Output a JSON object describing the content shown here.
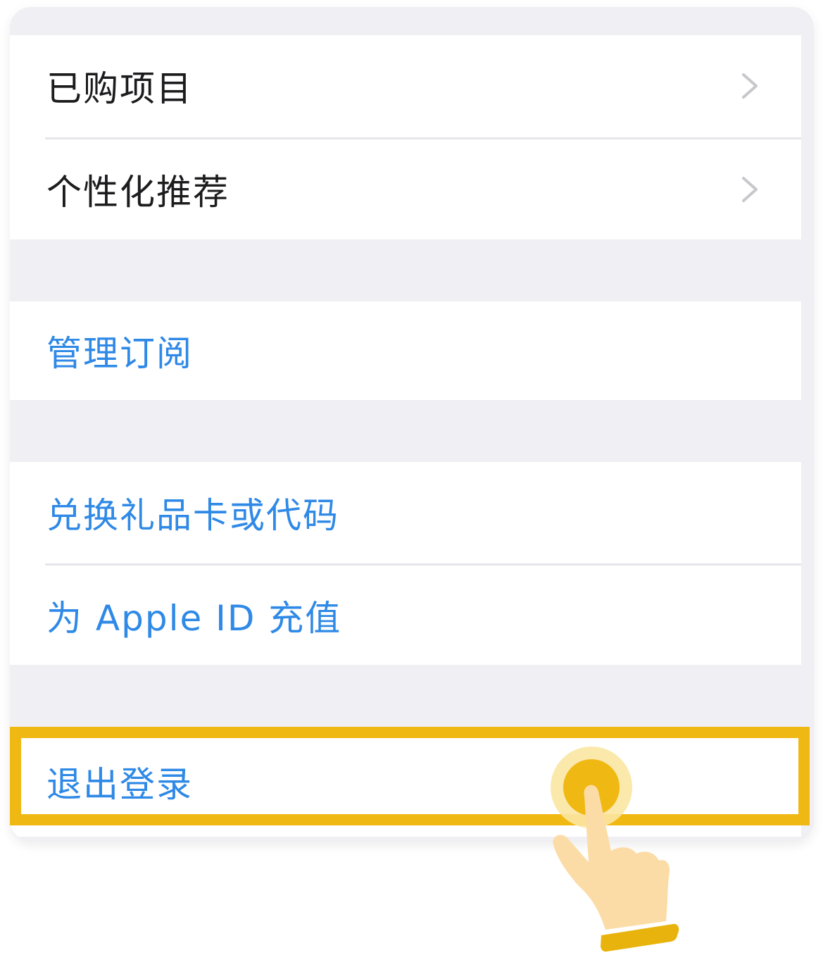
{
  "menu": {
    "purchased": {
      "label": "已购项目",
      "icon": "chevron-right-icon"
    },
    "personalized": {
      "label": "个性化推荐",
      "icon": "chevron-right-icon"
    },
    "manage_subscriptions": {
      "label": "管理订阅"
    },
    "redeem": {
      "label": "兑换礼品卡或代码"
    },
    "add_funds": {
      "label": "为 Apple ID 充值"
    },
    "sign_out": {
      "label": "退出登录"
    }
  },
  "colors": {
    "accent_blue": "#2f89e6",
    "highlight_yellow": "#f0b812",
    "background_gray": "#efeff4"
  },
  "overlay": {
    "tap_indicator": "tap-hand-icon"
  }
}
